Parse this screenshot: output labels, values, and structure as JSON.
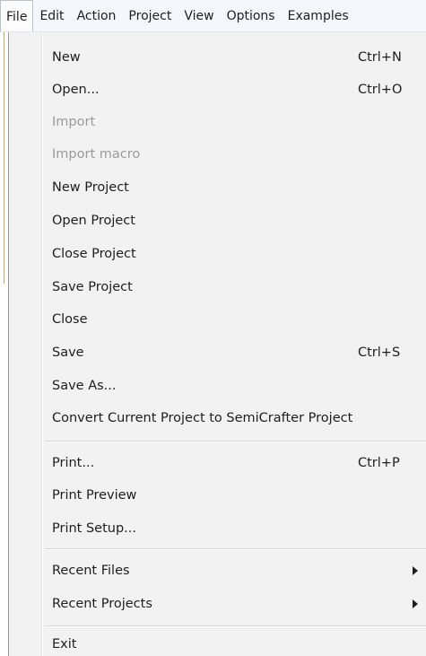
{
  "menubar": {
    "items": [
      "File",
      "Edit",
      "Action",
      "Project",
      "View",
      "Options",
      "Examples"
    ]
  },
  "file_menu": {
    "items": [
      {
        "label": "New",
        "shortcut": "Ctrl+N",
        "enabled": true
      },
      {
        "label": "Open...",
        "shortcut": "Ctrl+O",
        "enabled": true
      },
      {
        "label": "Import",
        "shortcut": "",
        "enabled": false
      },
      {
        "label": "Import macro",
        "shortcut": "",
        "enabled": false
      },
      {
        "label": "New Project",
        "shortcut": "",
        "enabled": true
      },
      {
        "label": "Open Project",
        "shortcut": "",
        "enabled": true
      },
      {
        "label": "Close Project",
        "shortcut": "",
        "enabled": true
      },
      {
        "label": "Save Project",
        "shortcut": "",
        "enabled": true
      },
      {
        "label": "Close",
        "shortcut": "",
        "enabled": true
      },
      {
        "label": "Save",
        "shortcut": "Ctrl+S",
        "enabled": true
      },
      {
        "label": "Save As...",
        "shortcut": "",
        "enabled": true
      },
      {
        "label": "Convert Current Project to SemiCrafter Project",
        "shortcut": "",
        "enabled": true
      },
      {
        "label": "Print...",
        "shortcut": "Ctrl+P",
        "enabled": true
      },
      {
        "label": "Print Preview",
        "shortcut": "",
        "enabled": true
      },
      {
        "label": "Print Setup...",
        "shortcut": "",
        "enabled": true
      },
      {
        "label": "Recent Files",
        "shortcut": "",
        "enabled": true,
        "submenu": true
      },
      {
        "label": "Recent Projects",
        "shortcut": "",
        "enabled": true,
        "submenu": true
      },
      {
        "label": "Exit",
        "shortcut": "",
        "enabled": true
      }
    ]
  }
}
